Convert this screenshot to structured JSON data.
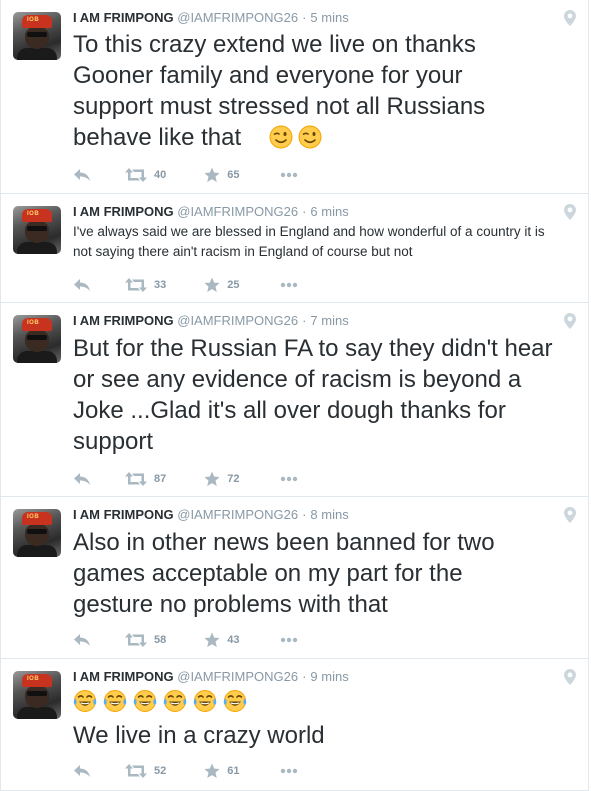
{
  "tweets": [
    {
      "name": "I AM FRIMPONG",
      "handle": "@IAMFRIMPONG26",
      "time": "5 mins",
      "text": "To this crazy extend we live on thanks Gooner family and everyone for your support must stressed not all Russians behave like that",
      "emojis": [
        "wink-face",
        "wink-face"
      ],
      "retweets": "40",
      "favorites": "65"
    },
    {
      "name": "I AM FRIMPONG",
      "handle": "@IAMFRIMPONG26",
      "time": "6 mins",
      "text": "I've always said we are blessed in England and how wonderful of a country it is not saying there ain't racism in England of course but not",
      "retweets": "33",
      "favorites": "25"
    },
    {
      "name": "I AM FRIMPONG",
      "handle": "@IAMFRIMPONG26",
      "time": "7 mins",
      "text": "But for the Russian FA to say they didn't hear or see any evidence of racism is beyond a Joke ...Glad it's all over dough thanks for support",
      "retweets": "87",
      "favorites": "72"
    },
    {
      "name": "I AM FRIMPONG",
      "handle": "@IAMFRIMPONG26",
      "time": "8 mins",
      "text": "Also in other news been banned for two games acceptable on my part for the gesture no problems with that",
      "retweets": "58",
      "favorites": "43"
    },
    {
      "name": "I AM FRIMPONG",
      "handle": "@IAMFRIMPONG26",
      "time": "9 mins",
      "text": "We live in a crazy world",
      "emojis": [
        "tears-of-joy-face",
        "tears-of-joy-face",
        "tears-of-joy-face",
        "tears-of-joy-face",
        "tears-of-joy-face",
        "tears-of-joy-face"
      ],
      "retweets": "52",
      "favorites": "61"
    }
  ]
}
